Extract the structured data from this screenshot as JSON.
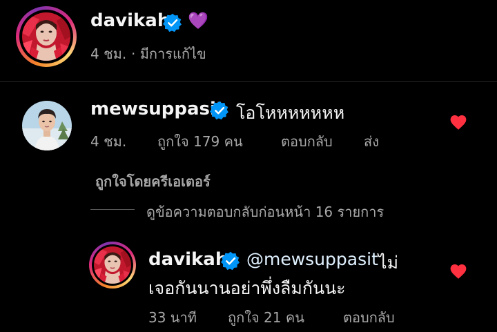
{
  "caption": {
    "username": "davikah",
    "emoji": "💜",
    "time": "4 ชม.",
    "edited": "· มีการแก้ไข"
  },
  "comment": {
    "username": "mewsuppasit",
    "text": "โอโหหหหหหห",
    "time": "4 ชม.",
    "likes": "ถูกใจ 179 คน",
    "reply_label": "ตอบกลับ",
    "send_label": "ส่ง",
    "liked_by_creator": "ถูกใจโดยครีเอเตอร์",
    "view_replies": "ดูข้อความตอบกลับก่อนหน้า 16 รายการ"
  },
  "reply": {
    "username": "davikah",
    "mention": "@mewsuppasit",
    "text_line1_suffix": " ไม่",
    "text_line2": "เจอกันนานอย่าพึ่งลืมกันนะ",
    "time": "33 นาที",
    "likes": "ถูกใจ 21 คน",
    "reply_label": "ตอบกลับ"
  },
  "colors": {
    "background": "#000000",
    "text_primary": "#f5f5f5",
    "text_secondary": "#a8a8a8",
    "verified_blue": "#0095f6",
    "mention_blue": "#e0f1ff",
    "heart_red": "#ff3040",
    "divider": "#262626"
  },
  "icons": {
    "verified": "verified-badge-icon",
    "like": "heart-icon"
  }
}
